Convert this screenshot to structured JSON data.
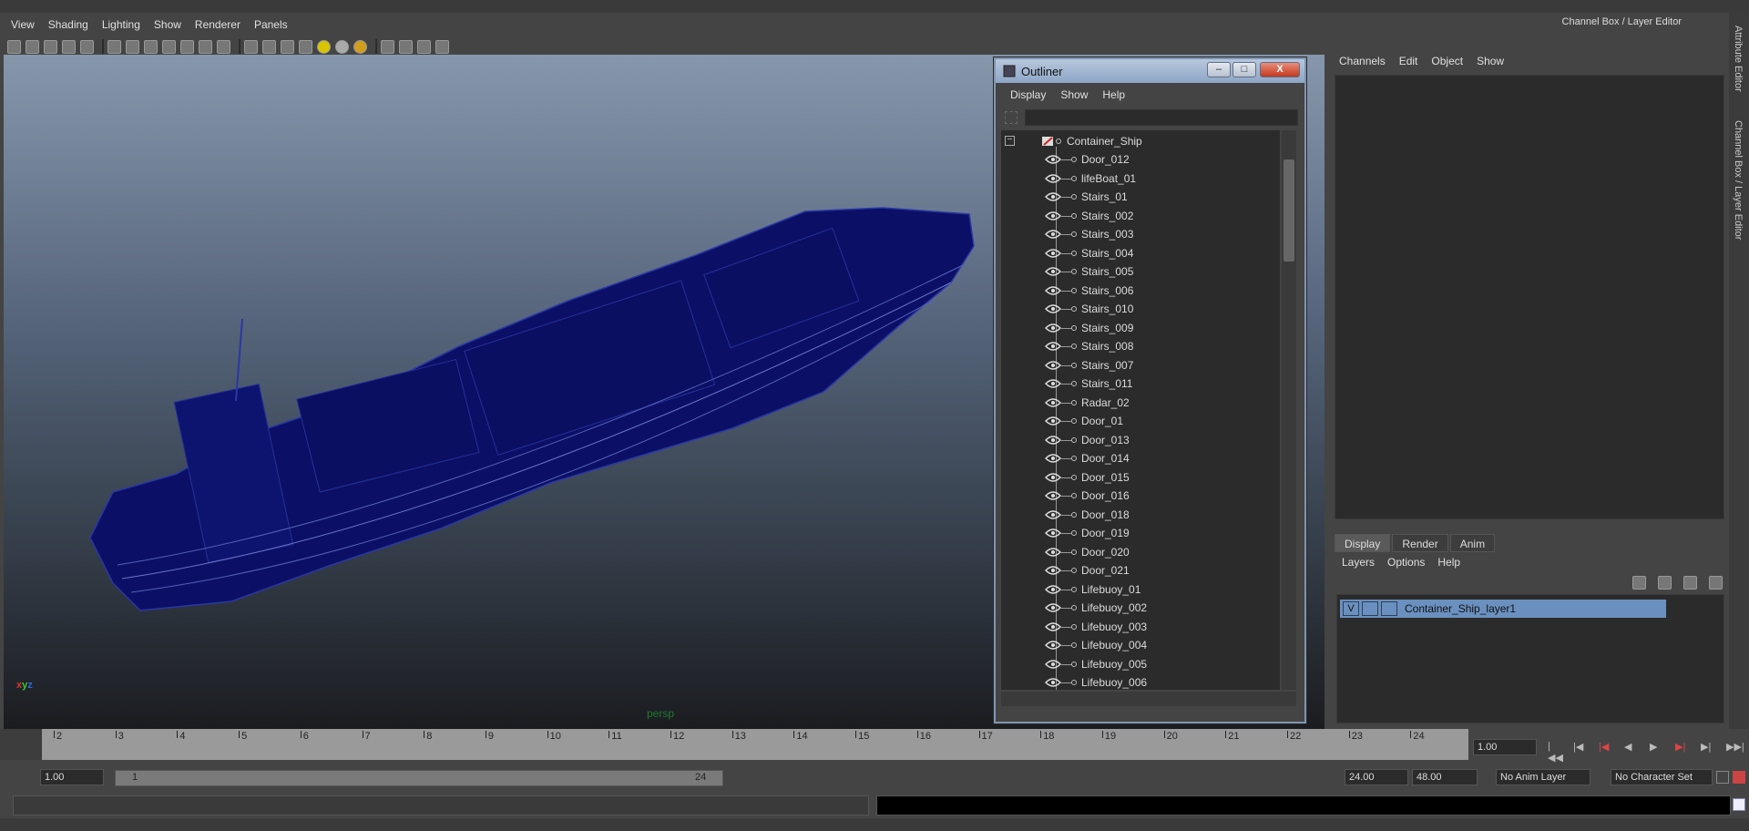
{
  "menubar": {
    "items": [
      "View",
      "Shading",
      "Lighting",
      "Show",
      "Renderer",
      "Panels"
    ]
  },
  "viewport": {
    "camera_label": "persp",
    "axis": {
      "x": "x",
      "y": "y",
      "z": "z"
    }
  },
  "outliner": {
    "title": "Outliner",
    "minimize": "–",
    "maximize": "□",
    "close": "X",
    "menu": [
      "Display",
      "Show",
      "Help"
    ],
    "root": "Container_Ship",
    "items": [
      "Door_012",
      "lifeBoat_01",
      "Stairs_01",
      "Stairs_002",
      "Stairs_003",
      "Stairs_004",
      "Stairs_005",
      "Stairs_006",
      "Stairs_010",
      "Stairs_009",
      "Stairs_008",
      "Stairs_007",
      "Stairs_011",
      "Radar_02",
      "Door_01",
      "Door_013",
      "Door_014",
      "Door_015",
      "Door_016",
      "Door_018",
      "Door_019",
      "Door_020",
      "Door_021",
      "Lifebuoy_01",
      "Lifebuoy_002",
      "Lifebuoy_003",
      "Lifebuoy_004",
      "Lifebuoy_005",
      "Lifebuoy_006"
    ]
  },
  "channelbox": {
    "title": "Channel Box / Layer Editor",
    "menu": [
      "Channels",
      "Edit",
      "Object",
      "Show"
    ]
  },
  "layer_editor": {
    "tabs": [
      "Display",
      "Render",
      "Anim"
    ],
    "active_tab": "Display",
    "menu": [
      "Layers",
      "Options",
      "Help"
    ],
    "layer": {
      "visible": "V",
      "name": "Container_Ship_layer1"
    }
  },
  "side_tabs": {
    "attribute_editor": "Attribute Editor",
    "channel_box": "Channel Box / Layer Editor"
  },
  "timeline": {
    "ticks": [
      "2",
      "3",
      "4",
      "5",
      "6",
      "7",
      "8",
      "9",
      "10",
      "11",
      "12",
      "13",
      "14",
      "15",
      "16",
      "17",
      "18",
      "19",
      "20",
      "21",
      "22",
      "23",
      "24"
    ],
    "current_frame": "1.00"
  },
  "range": {
    "start": "1.00",
    "slider_start": "1",
    "slider_end": "24",
    "end": "24.00",
    "max": "48.00",
    "anim_layer": "No Anim Layer",
    "character_set": "No Character Set"
  },
  "colors": {
    "selection": "#6a90bf",
    "viewport_top": "#8697ac",
    "mesh": "#0b1066"
  }
}
